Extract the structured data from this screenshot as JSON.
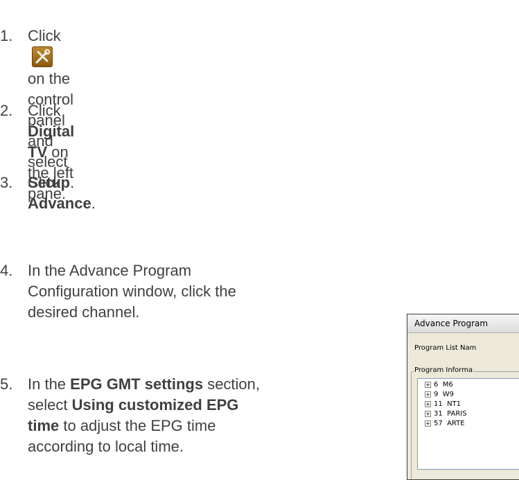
{
  "steps": [
    {
      "num": "1.",
      "pre": "Click",
      "post": " on the control panel and select ",
      "bold": "Setup",
      "end": "."
    },
    {
      "num": "2.",
      "pre": "Click ",
      "bold": "Digital TV",
      "post": " on the left pane."
    },
    {
      "num": "3.",
      "pre": "Click ",
      "bold": "Advance",
      "post": "."
    },
    {
      "num": "4.",
      "lines": [
        "In the Advance Program",
        "Configuration window, click the",
        "desired channel."
      ]
    },
    {
      "num": "5.",
      "l1_pre": "In the ",
      "l1_bold": "EPG GMT settings",
      "l1_post": " section,",
      "l2_pre": "select ",
      "l2_bold": "Using customized EPG",
      "l3_bold": "time",
      "l3_post": " to adjust the EPG time",
      "l4": "according to local time."
    }
  ],
  "icons": {
    "tools": "tools-icon"
  },
  "window": {
    "title": "Advance Program",
    "program_list_label": "Program List Nam",
    "program_info_label": "Program Informa",
    "channels": [
      {
        "num": "6",
        "name": "M6"
      },
      {
        "num": "9",
        "name": "W9"
      },
      {
        "num": "11",
        "name": "NT1"
      },
      {
        "num": "31",
        "name": "PARIS"
      },
      {
        "num": "57",
        "name": "ARTE"
      }
    ]
  }
}
